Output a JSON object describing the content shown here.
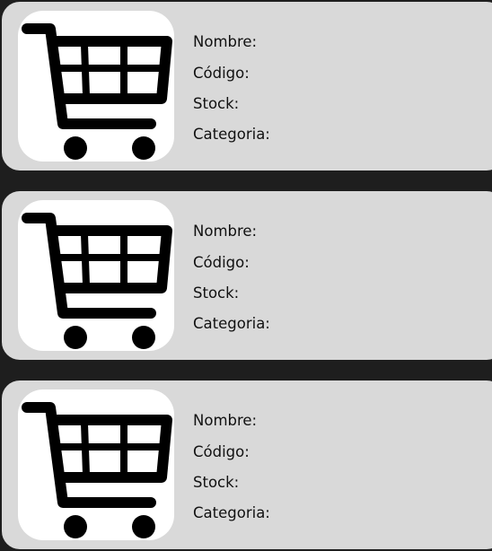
{
  "products": [
    {
      "image_icon": "shopping-cart-icon",
      "fields": {
        "name_label": "Nombre:",
        "code_label": "Código:",
        "stock_label": "Stock:",
        "category_label": "Categoria:"
      }
    },
    {
      "image_icon": "shopping-cart-icon",
      "fields": {
        "name_label": "Nombre:",
        "code_label": "Código:",
        "stock_label": "Stock:",
        "category_label": "Categoria:"
      }
    },
    {
      "image_icon": "shopping-cart-icon",
      "fields": {
        "name_label": "Nombre:",
        "code_label": "Código:",
        "stock_label": "Stock:",
        "category_label": "Categoria:"
      }
    }
  ],
  "colors": {
    "page_background": "#1e1e1e",
    "card_background": "#d9d9d9",
    "thumbnail_background": "#ffffff",
    "icon_color": "#000000"
  }
}
